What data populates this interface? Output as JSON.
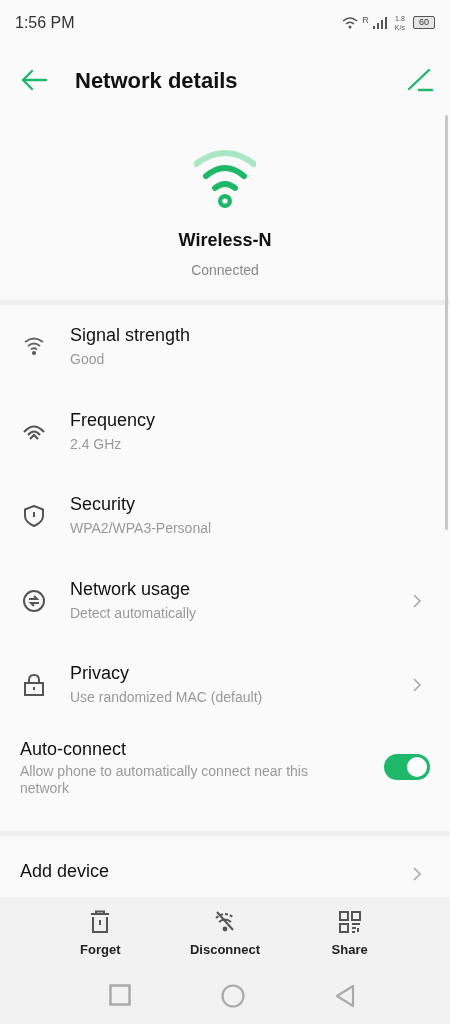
{
  "status_bar": {
    "time": "1:56 PM",
    "roaming": "R",
    "speed_value": "1.8",
    "speed_unit": "K/s",
    "battery": "60"
  },
  "header": {
    "title": "Network details"
  },
  "network": {
    "name": "Wireless-N",
    "status": "Connected"
  },
  "details": [
    {
      "kind": "info",
      "title": "Signal strength",
      "subtitle": "Good"
    },
    {
      "kind": "info",
      "title": "Frequency",
      "subtitle": "2.4 GHz"
    },
    {
      "kind": "info",
      "title": "Security",
      "subtitle": "WPA2/WPA3-Personal"
    },
    {
      "kind": "link",
      "title": "Network usage",
      "subtitle": "Detect automatically"
    },
    {
      "kind": "link",
      "title": "Privacy",
      "subtitle": "Use randomized MAC (default)"
    }
  ],
  "auto_connect": {
    "title": "Auto-connect",
    "subtitle": "Allow phone to automatically connect near this network",
    "on": true
  },
  "add_device": {
    "title": "Add device"
  },
  "actions": [
    {
      "label": "Forget"
    },
    {
      "label": "Disconnect"
    },
    {
      "label": "Share"
    }
  ]
}
